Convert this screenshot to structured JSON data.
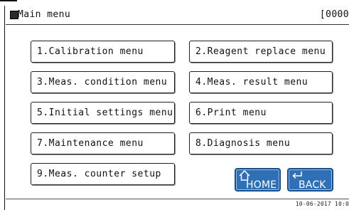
{
  "header": {
    "title": "Main menu",
    "screen_code": "[0000"
  },
  "menu": {
    "items": [
      {
        "label": "1.Calibration menu"
      },
      {
        "label": "2.Reagent replace menu"
      },
      {
        "label": "3.Meas. condition menu"
      },
      {
        "label": "4.Meas. result menu"
      },
      {
        "label": "5.Initial settings menu"
      },
      {
        "label": "6.Print menu"
      },
      {
        "label": "7.Maintenance menu"
      },
      {
        "label": "8.Diagnosis menu"
      },
      {
        "label": "9.Meas. counter setup"
      }
    ]
  },
  "nav": {
    "home_label": "HOME",
    "back_label": "BACK",
    "home_icon": "home-outline-arrow",
    "back_icon": "return-arrow",
    "button_color": "#2f6fb5"
  },
  "status": {
    "datetime": "10-06-2017 10:0"
  }
}
